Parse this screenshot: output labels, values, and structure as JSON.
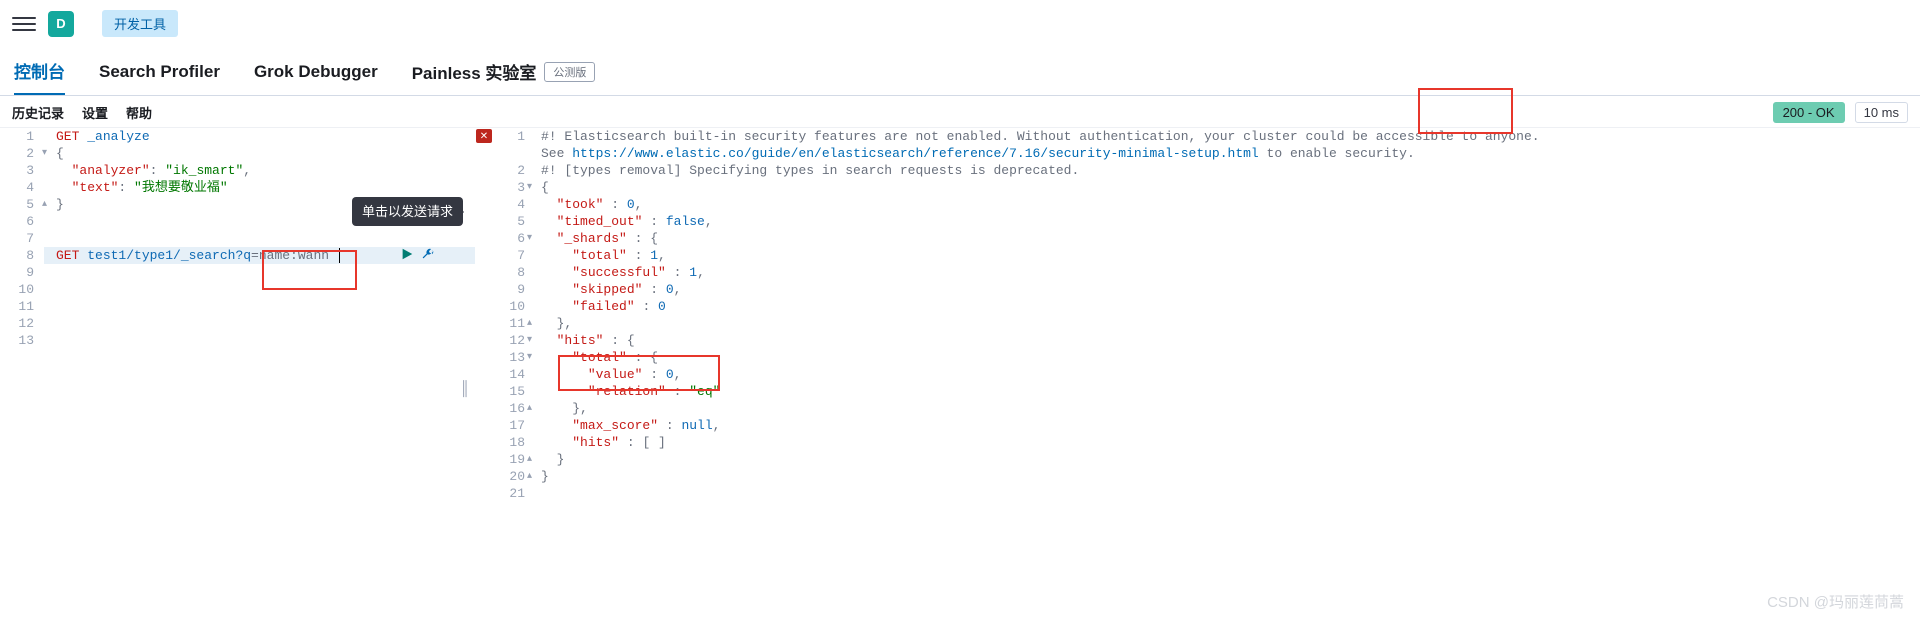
{
  "topbar": {
    "logo_letter": "D",
    "tool_chip": "开发工具"
  },
  "tabs": {
    "console": "控制台",
    "search_profiler": "Search Profiler",
    "grok": "Grok Debugger",
    "painless": "Painless 实验室",
    "beta": "公测版"
  },
  "subtabs": {
    "history": "历史记录",
    "settings": "设置",
    "help": "帮助"
  },
  "status": {
    "code": "200 - OK",
    "time": "10 ms"
  },
  "tooltip": {
    "run": "单击以发送请求"
  },
  "request": {
    "line1_method": "GET",
    "line1_path": "_analyze",
    "line2": "{",
    "line3_key": "\"analyzer\"",
    "line3_val": "\"ik_smart\"",
    "line4_key": "\"text\"",
    "line4_val": "\"我想要敬业福\"",
    "line5": "}",
    "line8_method": "GET",
    "line8_path_a": "test1/type1/_search?q",
    "line8_path_b": "=name:wann"
  },
  "response": {
    "warn1a": "#! Elasticsearch built-in security features are not enabled. Without authentication, your cluster could be accessible to anyone.",
    "warn1b": "See https://www.elastic.co/guide/en/elasticsearch/reference/7.16/security-minimal-setup.html to enable security.",
    "warn2": "#! [types removal] Specifying types in search requests is deprecated.",
    "l3": "{",
    "l4k": "\"took\"",
    "l4v": "0",
    "l5k": "\"timed_out\"",
    "l5v": "false",
    "l6k": "\"_shards\"",
    "l7k": "\"total\"",
    "l7v": "1",
    "l8k": "\"successful\"",
    "l8v": "1",
    "l9k": "\"skipped\"",
    "l9v": "0",
    "l10k": "\"failed\"",
    "l10v": "0",
    "l12k": "\"hits\"",
    "l13k": "\"total\"",
    "l14k": "\"value\"",
    "l14v": "0",
    "l15k": "\"relation\"",
    "l15v": "\"eq\"",
    "l17k": "\"max_score\"",
    "l17v": "null",
    "l18k": "\"hits\"",
    "l18v": "[ ]"
  },
  "watermark": "CSDN @玛丽莲茼蒿"
}
